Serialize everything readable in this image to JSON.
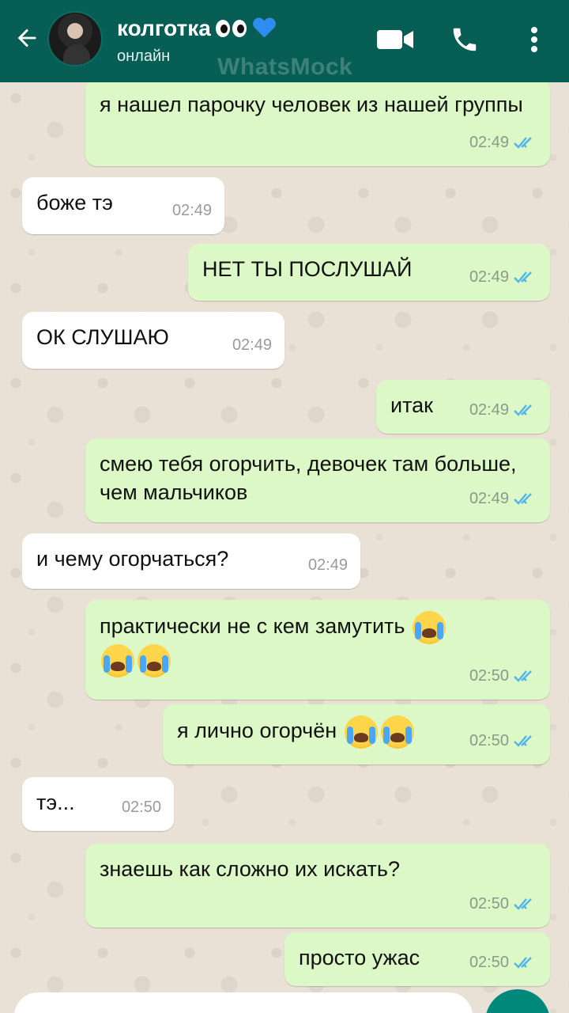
{
  "header": {
    "contact_name": "колготка",
    "status": "онлайн",
    "watermark": "WhatsMock",
    "colors": {
      "bar": "#075e54",
      "ticks": "#4fb6ec"
    },
    "icons": [
      "back-arrow-icon",
      "video-call-icon",
      "phone-icon",
      "more-vert-icon"
    ]
  },
  "messages": [
    {
      "dir": "out",
      "text": "я нашел парочку человек из нашей группы",
      "time": "02:49",
      "read": true
    },
    {
      "dir": "in",
      "text": "боже тэ",
      "time": "02:49"
    },
    {
      "dir": "out",
      "text": "НЕТ ТЫ ПОСЛУШАЙ",
      "time": "02:49",
      "read": true
    },
    {
      "dir": "in",
      "text": "ОК СЛУШАЮ",
      "time": "02:49"
    },
    {
      "dir": "out",
      "text": "итак",
      "time": "02:49",
      "read": true
    },
    {
      "dir": "out",
      "text": "смею тебя огорчить, девочек там больше, чем мальчиков",
      "time": "02:49",
      "read": true
    },
    {
      "dir": "in",
      "text": "и чему огорчаться?",
      "time": "02:49"
    },
    {
      "dir": "out",
      "text": "практически не с кем замутить",
      "emoji": [
        "loudly-crying-face",
        "loudly-crying-face",
        "loudly-crying-face"
      ],
      "time": "02:50",
      "read": true
    },
    {
      "dir": "out",
      "text": "я лично огорчён",
      "emoji": [
        "loudly-crying-face",
        "loudly-crying-face"
      ],
      "time": "02:50",
      "read": true
    },
    {
      "dir": "in",
      "text": "тэ...",
      "time": "02:50"
    },
    {
      "dir": "out",
      "text": "знаешь как сложно их искать?",
      "time": "02:50",
      "read": true
    },
    {
      "dir": "out",
      "text": "просто ужас",
      "time": "02:50",
      "read": true
    }
  ]
}
